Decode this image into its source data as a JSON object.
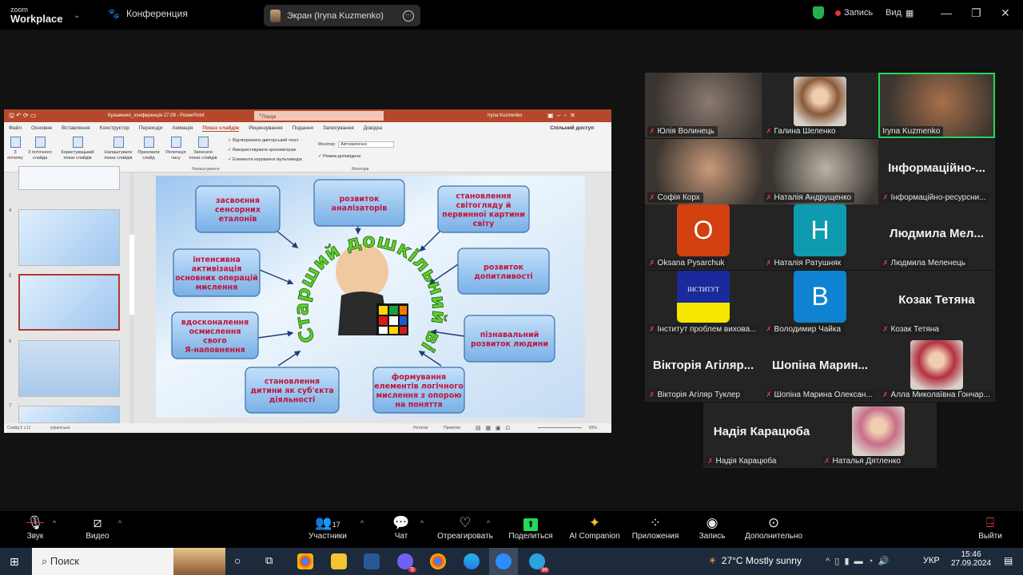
{
  "app": {
    "logo_small": "zoom",
    "logo_big": "Workplace",
    "meeting_label": "Конференция",
    "screen_label": "Экран (Iryna Kuzmenko)",
    "recording_label": "Запись",
    "view_label": "Вид"
  },
  "powerpoint": {
    "title": "Кузьменко_конференція 27.09  -  PowerPoint",
    "search_placeholder": "Пошук",
    "user": "Iryna Kuzmenko",
    "tabs": [
      "Файл",
      "Основне",
      "Вставлення",
      "Конструктор",
      "Переходи",
      "Анімація",
      "Показ слайдів",
      "Рецензування",
      "Подання",
      "Записування",
      "Довідка"
    ],
    "active_tab": "Показ слайдів",
    "share": "Спільний доступ",
    "ribbon": [
      "З початку",
      "З поточного слайда",
      "Користувацький показ слайдів",
      "Налаштувати показ слайдів",
      "Приховати слайд",
      "Репетиція часу",
      "Записати показ слайдів"
    ],
    "checks": [
      "Відтворювати дикторський текст",
      "Використовувати хронометраж",
      "Елементи керування мультимедіа",
      "Режим доповідача"
    ],
    "monitor_label": "Монітор:",
    "monitor_value": "Автоматично",
    "groups": [
      "Початок показу слайдів",
      "Налаштування",
      "Монітори"
    ],
    "thumb_numbers": [
      "4",
      "5",
      "6",
      "7"
    ],
    "status": {
      "slide": "Слайд 5 з 11",
      "lang": "українська",
      "notes": "Нотатки",
      "comments": "Примітки",
      "zoom": "83%"
    },
    "slide": {
      "boxes": [
        [
          "засвоєння",
          "сенсорних",
          "еталонів"
        ],
        [
          "розвиток",
          "аналізаторів"
        ],
        [
          "становлення",
          "світогляду й",
          "первинної картини",
          "світу"
        ],
        [
          "інтенсивна",
          "активізація",
          "основних операцій",
          "мислення"
        ],
        [
          "розвиток",
          "допитливості"
        ],
        [
          "вдосконалення",
          "осмислення",
          "свого",
          "Я-наповнення"
        ],
        [
          "пізнавальний",
          "розвиток людини"
        ],
        [
          "становлення",
          "дитини як суб'єкта",
          "діяльності"
        ],
        [
          "формування",
          "елементів логічного",
          "мислення з опорою",
          "на поняття"
        ]
      ],
      "circle_text": "Старший дошкільний вік"
    }
  },
  "participants": [
    {
      "name": "Юлія Волинець",
      "kind": "video",
      "color": "#8a7a70"
    },
    {
      "name": "Галина Шеленко",
      "kind": "photo",
      "color": "#8a5a3a"
    },
    {
      "name": "Iryna Kuzmenko",
      "kind": "video",
      "color": "#a8704a",
      "speaking": true,
      "unmuted": true
    },
    {
      "name": "Софія Корх",
      "kind": "video",
      "color": "#c99a7a"
    },
    {
      "name": "Наталія Андрущенко",
      "kind": "video",
      "color": "#b9b3a5"
    },
    {
      "name": "Інформаційно-ресурсни...",
      "kind": "name",
      "big": "Інформаційно-..."
    },
    {
      "name": "Oksana Pysarchuk",
      "kind": "avatar",
      "letter": "O",
      "color": "#d2410f"
    },
    {
      "name": "Наталія Ратушняк",
      "kind": "avatar",
      "letter": "H",
      "color": "#0e9bb0"
    },
    {
      "name": "Людмила Меленець",
      "kind": "name",
      "big": "Людмила  Мел..."
    },
    {
      "name": "Інститут проблем вихова...",
      "kind": "logo",
      "logo_text": "ІНСТИТУТ"
    },
    {
      "name": "Володимир Чайка",
      "kind": "avatar",
      "letter": "B",
      "color": "#0f83d1"
    },
    {
      "name": "Козак Тетяна",
      "kind": "name",
      "big": "Козак Тетяна"
    },
    {
      "name": "Вікторія Агіляр Туклер",
      "kind": "name",
      "big": "Вікторія Агіляр..."
    },
    {
      "name": "Шопіна Марина Олексан...",
      "kind": "name",
      "big": "Шопіна  Марин..."
    },
    {
      "name": "Алла Миколаївна Гончар...",
      "kind": "photo",
      "color": "#b23040"
    },
    {
      "name": "Надія Карацюба",
      "kind": "name",
      "big": "Надія Карацюба"
    },
    {
      "name": "Наталья Дятленко",
      "kind": "photo",
      "color": "#c7708a"
    }
  ],
  "toolbar": {
    "audio": "Звук",
    "video": "Видео",
    "participants": "Участники",
    "participants_count": "17",
    "chat": "Чат",
    "react": "Отреагировать",
    "share": "Поделиться",
    "ai": "AI Companion",
    "apps": "Приложения",
    "record": "Запись",
    "more": "Дополнительно",
    "leave": "Выйти"
  },
  "taskbar": {
    "search": "Поиск",
    "weather": "27°C  Mostly sunny",
    "lang": "УКР",
    "time": "15:46",
    "date": "27.09.2024",
    "viber_badge": "5",
    "telegram_badge": "99"
  },
  "colors": {
    "accent_ppt": "#b7472a",
    "speaking": "#23d959",
    "slide_text": "#c0143c",
    "circle_text": "#5fd12a"
  }
}
